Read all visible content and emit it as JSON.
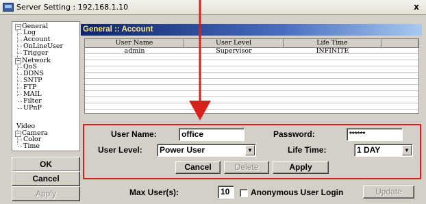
{
  "window": {
    "title": "Server Setting : 192.168.1.10",
    "close_label": "x"
  },
  "tree": {
    "items": [
      {
        "label": "General",
        "level": 0,
        "expander": "−"
      },
      {
        "label": "Log",
        "level": 1
      },
      {
        "label": "Account",
        "level": 1
      },
      {
        "label": "OnLineUser",
        "level": 1
      },
      {
        "label": "Trigger",
        "level": 1
      },
      {
        "label": "Network",
        "level": 0,
        "expander": "−"
      },
      {
        "label": "QoS",
        "level": 1
      },
      {
        "label": "DDNS",
        "level": 1
      },
      {
        "label": "SNTP",
        "level": 1
      },
      {
        "label": "FTP",
        "level": 1
      },
      {
        "label": "MAIL",
        "level": 1
      },
      {
        "label": "Filter",
        "level": 1
      },
      {
        "label": "UPnP",
        "level": 1
      },
      {
        "label": "Video",
        "level": 0
      },
      {
        "label": "Camera",
        "level": 0,
        "expander": "−"
      },
      {
        "label": "Color",
        "level": 1
      },
      {
        "label": "Time",
        "level": 1
      }
    ]
  },
  "sidebar_buttons": {
    "ok": "OK",
    "cancel": "Cancel",
    "apply": "Apply"
  },
  "section": {
    "title": "General :: Account"
  },
  "account_table": {
    "columns": [
      "User Name",
      "User Level",
      "Life Time",
      ""
    ],
    "rows": [
      [
        "admin",
        "Supervisor",
        "INFINITE",
        ""
      ]
    ],
    "empty_rows": 10
  },
  "form": {
    "user_name_label": "User Name:",
    "user_name_value": "office",
    "password_label": "Password:",
    "password_value": "******",
    "user_level_label": "User Level:",
    "user_level_value": "Power User",
    "life_time_label": "Life Time:",
    "life_time_value": "1 DAY",
    "cancel_label": "Cancel",
    "delete_label": "Delete",
    "apply_label": "Apply"
  },
  "footer": {
    "max_users_label": "Max User(s):",
    "max_users_value": "10",
    "anonymous_label": "Anonymous User Login",
    "anonymous_checked": false,
    "update_label": "Update"
  },
  "colors": {
    "highlight_box": "#d8201c",
    "annotation_arrow": "#d8201c",
    "section_title_text": "#ffe68a"
  }
}
